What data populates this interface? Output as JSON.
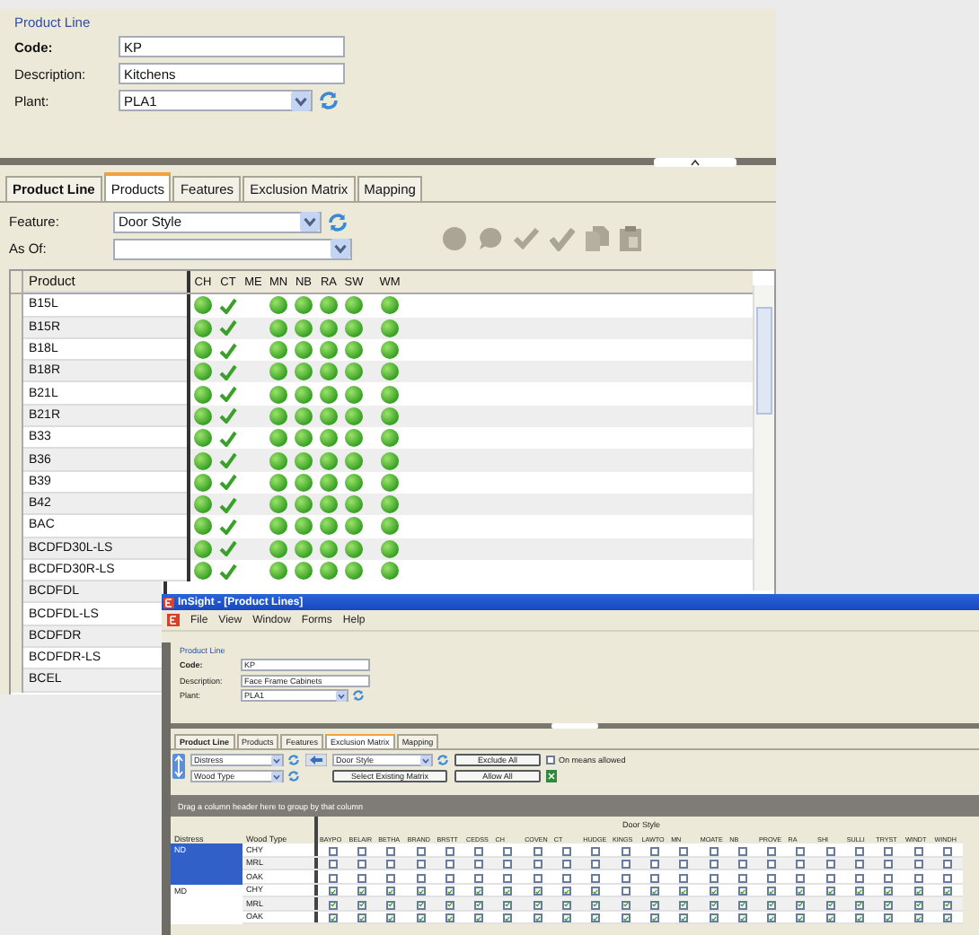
{
  "back_window": {
    "product_line": {
      "title": "Product Line",
      "fields": [
        {
          "label": "Code:",
          "value": "KP",
          "kind": "text",
          "bold": true
        },
        {
          "label": "Description:",
          "value": "Kitchens",
          "kind": "text",
          "bold": false
        },
        {
          "label": "Plant:",
          "value": "PLA1",
          "kind": "dropdown",
          "bold": false
        }
      ]
    },
    "tabs": [
      {
        "label": "Product Line",
        "bold": true,
        "selected": false
      },
      {
        "label": "Products",
        "bold": false,
        "selected": true
      },
      {
        "label": "Features",
        "bold": false,
        "selected": false
      },
      {
        "label": "Exclusion Matrix",
        "bold": false,
        "selected": false
      },
      {
        "label": "Mapping",
        "bold": false,
        "selected": false
      }
    ],
    "feature": {
      "label": "Feature:",
      "value": "Door Style"
    },
    "as_of": {
      "label": "As Of:"
    },
    "grid": {
      "columns": [
        "Product",
        "CH",
        "CT",
        "ME",
        "MN",
        "NB",
        "RA",
        "SW",
        "WM"
      ],
      "rows": [
        {
          "product": "B15L",
          "cells": [
            {
              "kind": "dot"
            },
            {
              "kind": "check"
            },
            {
              "kind": "empty"
            },
            {
              "kind": "dot"
            },
            {
              "kind": "dot"
            },
            {
              "kind": "dot"
            },
            {
              "kind": "dot"
            },
            {
              "kind": "dot"
            }
          ]
        },
        {
          "product": "B15R",
          "cells": [
            {
              "kind": "dot"
            },
            {
              "kind": "check"
            },
            {
              "kind": "empty"
            },
            {
              "kind": "dot"
            },
            {
              "kind": "dot"
            },
            {
              "kind": "dot"
            },
            {
              "kind": "dot"
            },
            {
              "kind": "dot"
            }
          ]
        },
        {
          "product": "B18L",
          "cells": [
            {
              "kind": "dot"
            },
            {
              "kind": "check"
            },
            {
              "kind": "empty"
            },
            {
              "kind": "dot"
            },
            {
              "kind": "dot"
            },
            {
              "kind": "dot"
            },
            {
              "kind": "dot"
            },
            {
              "kind": "dot"
            }
          ]
        },
        {
          "product": "B18R",
          "cells": [
            {
              "kind": "dot"
            },
            {
              "kind": "check"
            },
            {
              "kind": "empty"
            },
            {
              "kind": "dot"
            },
            {
              "kind": "dot"
            },
            {
              "kind": "dot"
            },
            {
              "kind": "dot"
            },
            {
              "kind": "dot"
            }
          ]
        },
        {
          "product": "B21L",
          "cells": [
            {
              "kind": "dot"
            },
            {
              "kind": "check"
            },
            {
              "kind": "empty"
            },
            {
              "kind": "dot"
            },
            {
              "kind": "dot"
            },
            {
              "kind": "dot"
            },
            {
              "kind": "dot"
            },
            {
              "kind": "dot"
            }
          ]
        },
        {
          "product": "B21R",
          "cells": [
            {
              "kind": "dot"
            },
            {
              "kind": "check"
            },
            {
              "kind": "empty"
            },
            {
              "kind": "dot"
            },
            {
              "kind": "dot"
            },
            {
              "kind": "dot"
            },
            {
              "kind": "dot"
            },
            {
              "kind": "dot"
            }
          ]
        },
        {
          "product": "B33",
          "cells": [
            {
              "kind": "dot"
            },
            {
              "kind": "check"
            },
            {
              "kind": "empty"
            },
            {
              "kind": "dot"
            },
            {
              "kind": "dot"
            },
            {
              "kind": "dot"
            },
            {
              "kind": "dot"
            },
            {
              "kind": "dot"
            }
          ]
        },
        {
          "product": "B36",
          "cells": [
            {
              "kind": "dot"
            },
            {
              "kind": "check"
            },
            {
              "kind": "empty"
            },
            {
              "kind": "dot"
            },
            {
              "kind": "dot"
            },
            {
              "kind": "dot"
            },
            {
              "kind": "dot"
            },
            {
              "kind": "dot"
            }
          ]
        },
        {
          "product": "B39",
          "cells": [
            {
              "kind": "dot"
            },
            {
              "kind": "check"
            },
            {
              "kind": "empty"
            },
            {
              "kind": "dot"
            },
            {
              "kind": "dot"
            },
            {
              "kind": "dot"
            },
            {
              "kind": "dot"
            },
            {
              "kind": "dot"
            }
          ]
        },
        {
          "product": "B42",
          "cells": [
            {
              "kind": "dot"
            },
            {
              "kind": "check"
            },
            {
              "kind": "empty"
            },
            {
              "kind": "dot"
            },
            {
              "kind": "dot"
            },
            {
              "kind": "dot"
            },
            {
              "kind": "dot"
            },
            {
              "kind": "dot"
            }
          ]
        },
        {
          "product": "BAC",
          "cells": [
            {
              "kind": "dot"
            },
            {
              "kind": "check"
            },
            {
              "kind": "empty"
            },
            {
              "kind": "dot"
            },
            {
              "kind": "dot"
            },
            {
              "kind": "dot"
            },
            {
              "kind": "dot"
            },
            {
              "kind": "dot"
            }
          ]
        },
        {
          "product": "BCDFD30L-LS",
          "cells": [
            {
              "kind": "dot"
            },
            {
              "kind": "check"
            },
            {
              "kind": "empty"
            },
            {
              "kind": "dot"
            },
            {
              "kind": "dot"
            },
            {
              "kind": "dot"
            },
            {
              "kind": "dot"
            },
            {
              "kind": "dot"
            }
          ]
        },
        {
          "product": "BCDFD30R-LS",
          "cells": [
            {
              "kind": "dot"
            },
            {
              "kind": "check"
            },
            {
              "kind": "empty"
            },
            {
              "kind": "dot"
            },
            {
              "kind": "dot"
            },
            {
              "kind": "dot"
            },
            {
              "kind": "dot"
            },
            {
              "kind": "dot"
            }
          ]
        },
        {
          "product": "BCDFDL"
        },
        {
          "product": "BCDFDL-LS"
        },
        {
          "product": "BCDFDR"
        },
        {
          "product": "BCDFDR-LS"
        },
        {
          "product": "BCEL"
        }
      ]
    }
  },
  "front_window": {
    "title": "InSight - [Product Lines]",
    "menu": [
      "File",
      "View",
      "Window",
      "Forms",
      "Help"
    ],
    "product_line": {
      "title": "Product Line",
      "fields": [
        {
          "label": "Code:",
          "value": "KP",
          "kind": "text",
          "bold": true
        },
        {
          "label": "Description:",
          "value": "Face Frame Cabinets",
          "kind": "text",
          "bold": false
        },
        {
          "label": "Plant:",
          "value": "PLA1",
          "kind": "dropdown",
          "bold": false
        }
      ]
    },
    "tabs": [
      {
        "label": "Product Line",
        "bold": true,
        "selected": false
      },
      {
        "label": "Products",
        "bold": false,
        "selected": false
      },
      {
        "label": "Features",
        "bold": false,
        "selected": false
      },
      {
        "label": "Exclusion Matrix",
        "bold": false,
        "selected": true
      },
      {
        "label": "Mapping",
        "bold": false,
        "selected": false
      }
    ],
    "row_features": [
      "Distress",
      "Wood Type"
    ],
    "column_feature": "Door Style",
    "buttons": [
      "Select Existing Matrix",
      "Exclude All",
      "Allow All"
    ],
    "on_means_allowed": {
      "label": "On means allowed",
      "checked": false
    },
    "group_hint": "Drag a column header here to group by that column",
    "matrix": {
      "row_columns": [
        "Distress",
        "Wood Type"
      ],
      "column_group": "Door Style",
      "columns": [
        "BAYPO",
        "BELAIR",
        "BETHA",
        "BRAND",
        "BRSTT",
        "CEDSS",
        "CH",
        "COVEN",
        "CT",
        "HUDGE",
        "KINGS",
        "LAWTO",
        "MN",
        "MOATE",
        "NB",
        "PROVE",
        "RA",
        "SHI",
        "SULLI",
        "TRYST",
        "WINDT",
        "WINDH"
      ],
      "groups": [
        {
          "distress": "ND",
          "selected": true,
          "rows": [
            {
              "wood_type": "CHY",
              "checks": [
                false,
                false,
                false,
                false,
                false,
                false,
                false,
                false,
                false,
                false,
                false,
                false,
                false,
                false,
                false,
                false,
                false,
                false,
                false,
                false,
                false,
                false
              ]
            },
            {
              "wood_type": "MRL",
              "checks": [
                false,
                false,
                false,
                false,
                false,
                false,
                false,
                false,
                false,
                false,
                false,
                false,
                false,
                false,
                false,
                false,
                false,
                false,
                false,
                false,
                false,
                false
              ]
            },
            {
              "wood_type": "OAK",
              "checks": [
                false,
                false,
                false,
                false,
                false,
                false,
                false,
                false,
                false,
                false,
                false,
                false,
                false,
                false,
                false,
                false,
                false,
                false,
                false,
                false,
                false,
                false
              ]
            }
          ]
        },
        {
          "distress": "MD",
          "selected": false,
          "rows": [
            {
              "wood_type": "CHY",
              "checks": [
                true,
                true,
                true,
                true,
                true,
                true,
                true,
                true,
                true,
                true,
                false,
                true,
                true,
                true,
                true,
                true,
                true,
                true,
                true,
                true,
                true,
                true
              ]
            },
            {
              "wood_type": "MRL",
              "checks": [
                true,
                true,
                true,
                true,
                true,
                true,
                true,
                true,
                true,
                true,
                true,
                true,
                true,
                true,
                true,
                true,
                true,
                true,
                true,
                true,
                true,
                true
              ]
            },
            {
              "wood_type": "OAK",
              "checks": [
                true,
                true,
                true,
                true,
                true,
                true,
                true,
                true,
                true,
                true,
                true,
                true,
                true,
                true,
                true,
                true,
                true,
                true,
                true,
                true,
                true,
                true
              ]
            }
          ]
        }
      ]
    }
  }
}
